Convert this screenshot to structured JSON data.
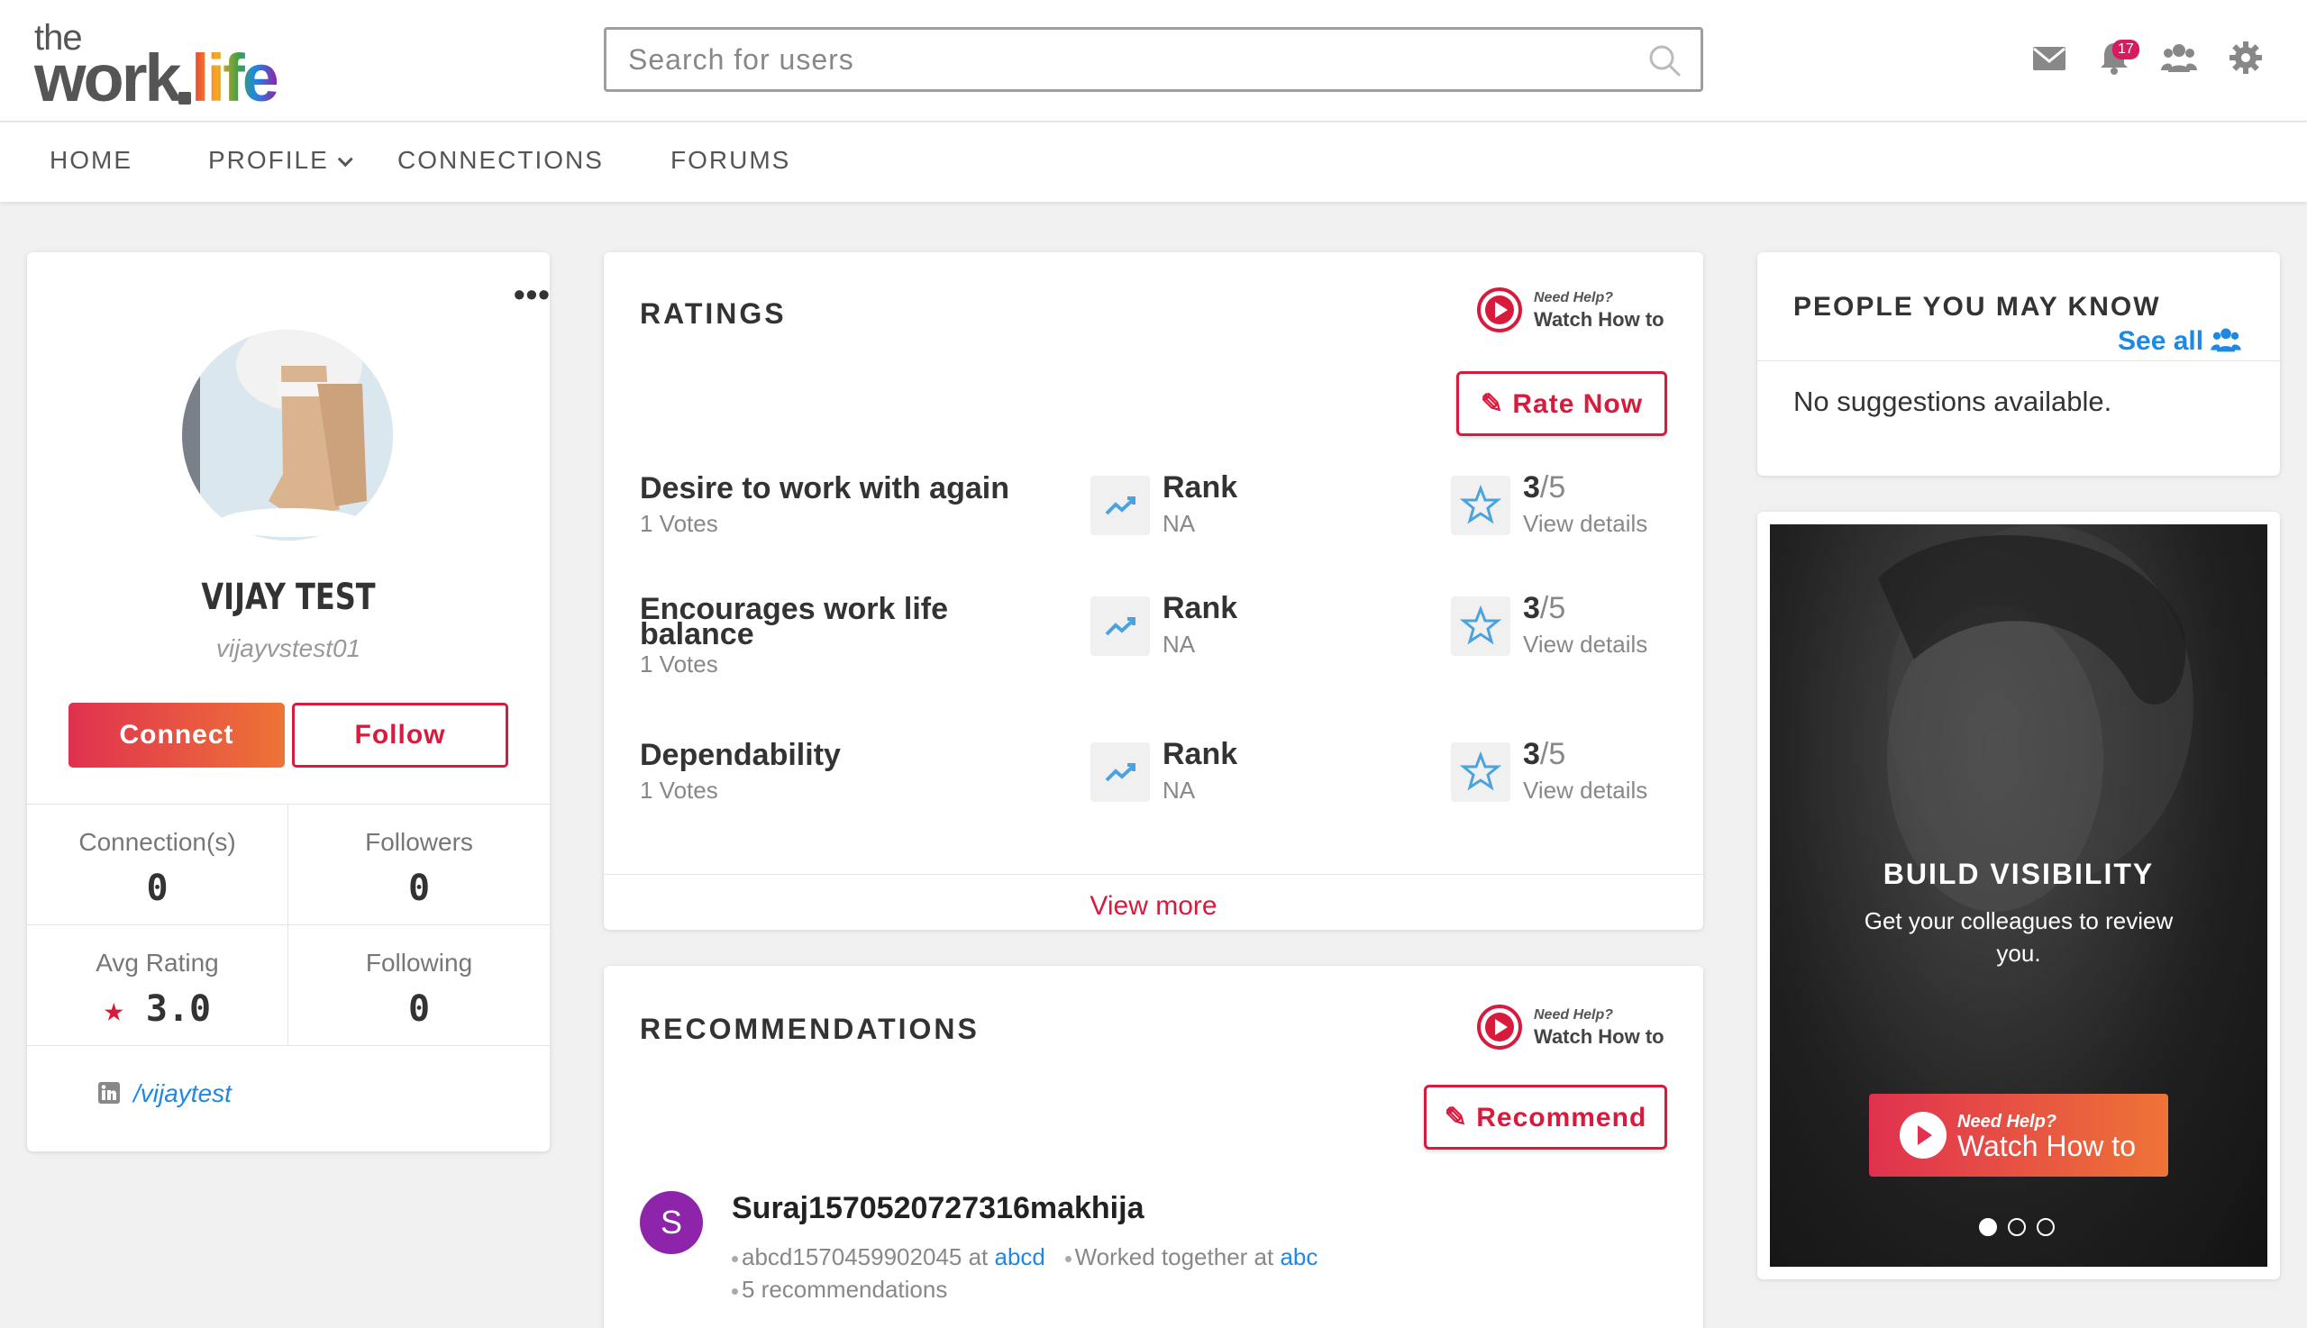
{
  "logo": {
    "the": "the",
    "work": "work",
    "life": "life"
  },
  "search": {
    "placeholder": "Search for users"
  },
  "header": {
    "notification_count": "17",
    "accent": "#d81b3c"
  },
  "nav": {
    "home": "HOME",
    "profile": "PROFILE",
    "connections": "CONNECTIONS",
    "forums": "FORUMS"
  },
  "profile": {
    "name": "VIJAY TEST",
    "username": "vijayvstest01",
    "connect_label": "Connect",
    "follow_label": "Follow",
    "connections_label": "Connection(s)",
    "connections_value": "0",
    "followers_label": "Followers",
    "followers_value": "0",
    "avg_rating_label": "Avg Rating",
    "avg_rating_value": "3.0",
    "following_label": "Following",
    "following_value": "0",
    "linkedin": "/vijaytest"
  },
  "help": {
    "line1": "Need Help?",
    "line2": "Watch How to"
  },
  "ratings": {
    "title": "RATINGS",
    "rate_now_label": "Rate Now",
    "rank_label": "Rank",
    "view_details": "View details",
    "items": [
      {
        "name": "Desire to work with again",
        "votes": "1 Votes",
        "rank": "NA",
        "score": "3",
        "out_of": "/5"
      },
      {
        "name": "Encourages work life balance",
        "votes": "1 Votes",
        "rank": "NA",
        "score": "3",
        "out_of": "/5"
      },
      {
        "name": "Dependability",
        "votes": "1 Votes",
        "rank": "NA",
        "score": "3",
        "out_of": "/5"
      }
    ],
    "view_more": "View more"
  },
  "recommendations": {
    "title": "RECOMMENDATIONS",
    "recommend_label": "Recommend",
    "item": {
      "initial": "S",
      "name": "Suraj1570520727316makhija",
      "position": "abcd1570459902045",
      "at_word": "at",
      "company": "abcd",
      "worked_together": "Worked together at",
      "worked_company": "abc",
      "count": "5 recommendations"
    }
  },
  "people": {
    "title": "PEOPLE YOU MAY KNOW",
    "see_all": "See all",
    "empty": "No suggestions available."
  },
  "promo": {
    "title": "BUILD VISIBILITY",
    "subtitle": "Get your colleagues to review you.",
    "btn_line1": "Need Help?",
    "btn_line2": "Watch How to",
    "active_slide": 1,
    "slides": 3
  }
}
